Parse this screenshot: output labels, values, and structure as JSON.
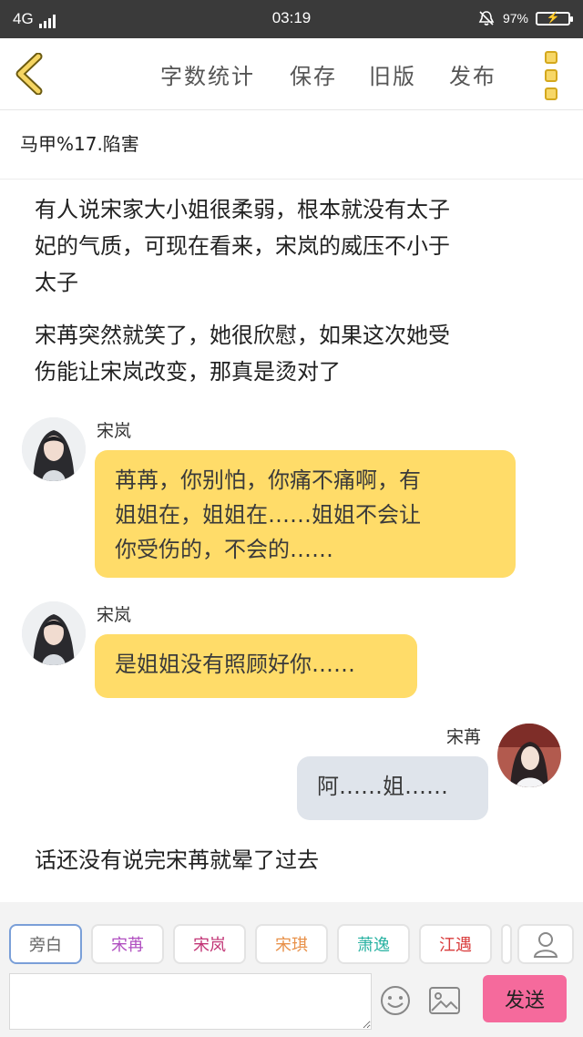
{
  "status_bar": {
    "network": "4G",
    "time": "03:19",
    "battery": "97%"
  },
  "toolbar": {
    "word_count": "字数统计",
    "save": "保存",
    "old_version": "旧版",
    "publish": "发布"
  },
  "chapter_title": "马甲%17.陷害",
  "messages": {
    "narration_1": [
      "有人说宋家大小姐很柔弱，根本就没有太子",
      "妃的气质，可现在看来，宋岚的威压不小于",
      "太子"
    ],
    "narration_2": [
      "宋苒突然就笑了，她很欣慰，如果这次她受",
      "伤能让宋岚改变，那真是烫对了"
    ],
    "dialog_1": {
      "speaker": "宋岚",
      "lines": [
        "苒苒，你别怕，你痛不痛啊，有",
        "姐姐在，姐姐在……姐姐不会让",
        "你受伤的，不会的……"
      ]
    },
    "dialog_2": {
      "speaker": "宋岚",
      "text": "是姐姐没有照顾好你……"
    },
    "dialog_3": {
      "speaker": "宋苒",
      "text": "阿……姐……"
    },
    "narration_3": "话还没有说完宋苒就晕了过去"
  },
  "characters": [
    {
      "label": "旁白",
      "color": "#666666"
    },
    {
      "label": "宋苒",
      "color": "#b04fc0"
    },
    {
      "label": "宋岚",
      "color": "#c23576"
    },
    {
      "label": "宋琪",
      "color": "#e8914a"
    },
    {
      "label": "萧逸",
      "color": "#2bb3a3"
    },
    {
      "label": "江遇",
      "color": "#d93c3c"
    }
  ],
  "composer": {
    "send_label": "发送",
    "input_value": ""
  },
  "colors": {
    "accent_yellow": "#ffdc69",
    "send_pink": "#f56a9c",
    "bubble_gray": "#dfe4eb"
  },
  "icons": [
    "back-icon",
    "menu-icon",
    "user-icon",
    "emoji-icon",
    "image-icon",
    "alarm-off-icon",
    "battery-icon"
  ]
}
